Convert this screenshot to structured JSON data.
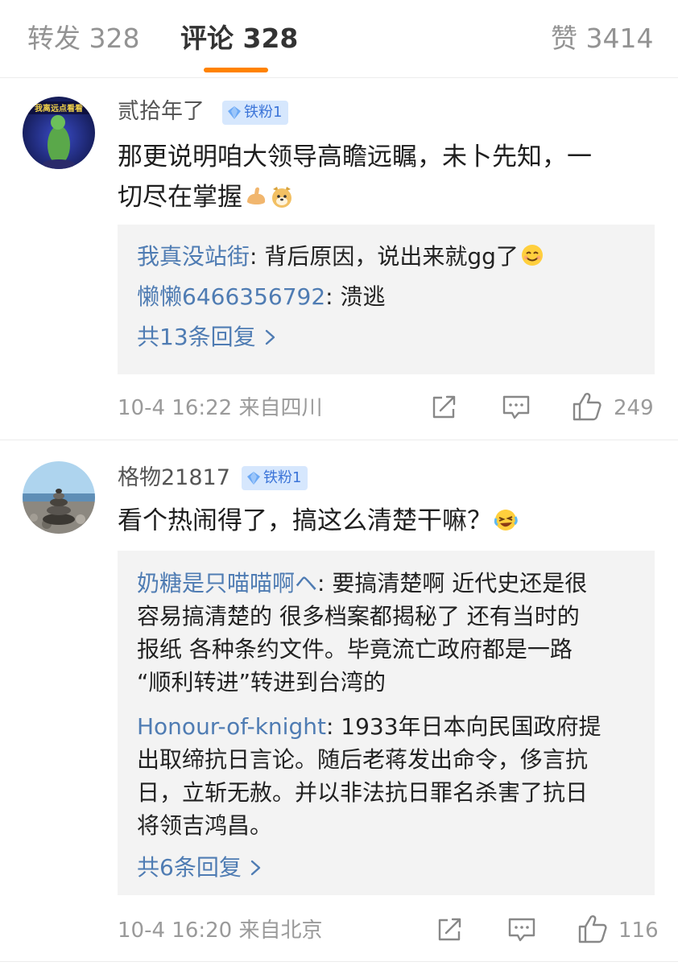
{
  "tabs": {
    "repost": "转发 328",
    "comments": "评论 328",
    "likes": "赞 3414"
  },
  "colors": {
    "accent": "#ff8200",
    "link": "#4f7cb3",
    "badge_bg": "#d6e7fd",
    "badge_text": "#3b74d8"
  },
  "comments": [
    {
      "username": "贰拾年了",
      "badge": "铁粉1",
      "text_line1": "那更说明咱大领导高瞻远瞩，未卜先知，一",
      "text_line2": "切尽在掌握",
      "emojis": [
        "flexed-biceps-emoji",
        "doge-emoji"
      ],
      "replies": [
        {
          "name": "我真没站街",
          "text": ": 背后原因，说出来就gg了",
          "emoji": "smile-emoji"
        },
        {
          "name": "懒懒6466356792",
          "text": ": 溃逃"
        }
      ],
      "more_replies": "共13条回复",
      "time_location": "10-4 16:22  来自四川",
      "likes": "249",
      "avatar_text": "我离远点看看"
    },
    {
      "username": "格物21817",
      "badge": "铁粉1",
      "text": "看个热闹得了，搞这么清楚干嘛？",
      "emoji": "laughing-tears-emoji",
      "replies": [
        {
          "name": "奶糖是只喵喵啊ヘ",
          "lines": [
            ": 要搞清楚啊 近代史还是很",
            "容易搞清楚的 很多档案都揭秘了 还有当时的",
            "报纸 各种条约文件。毕竟流亡政府都是一路",
            "“顺利转进”转进到台湾的"
          ]
        },
        {
          "name": "Honour-of-knight",
          "lines": [
            ": 1933年日本向民国政府提",
            "出取缔抗日言论。随后老蒋发出命令，侈言抗",
            "日，立斩无赦。并以非法抗日罪名杀害了抗日",
            "将领吉鸿昌。"
          ]
        }
      ],
      "more_replies": "共6条回复",
      "time_location": "10-4 16:20  来自北京",
      "likes": "116"
    }
  ]
}
